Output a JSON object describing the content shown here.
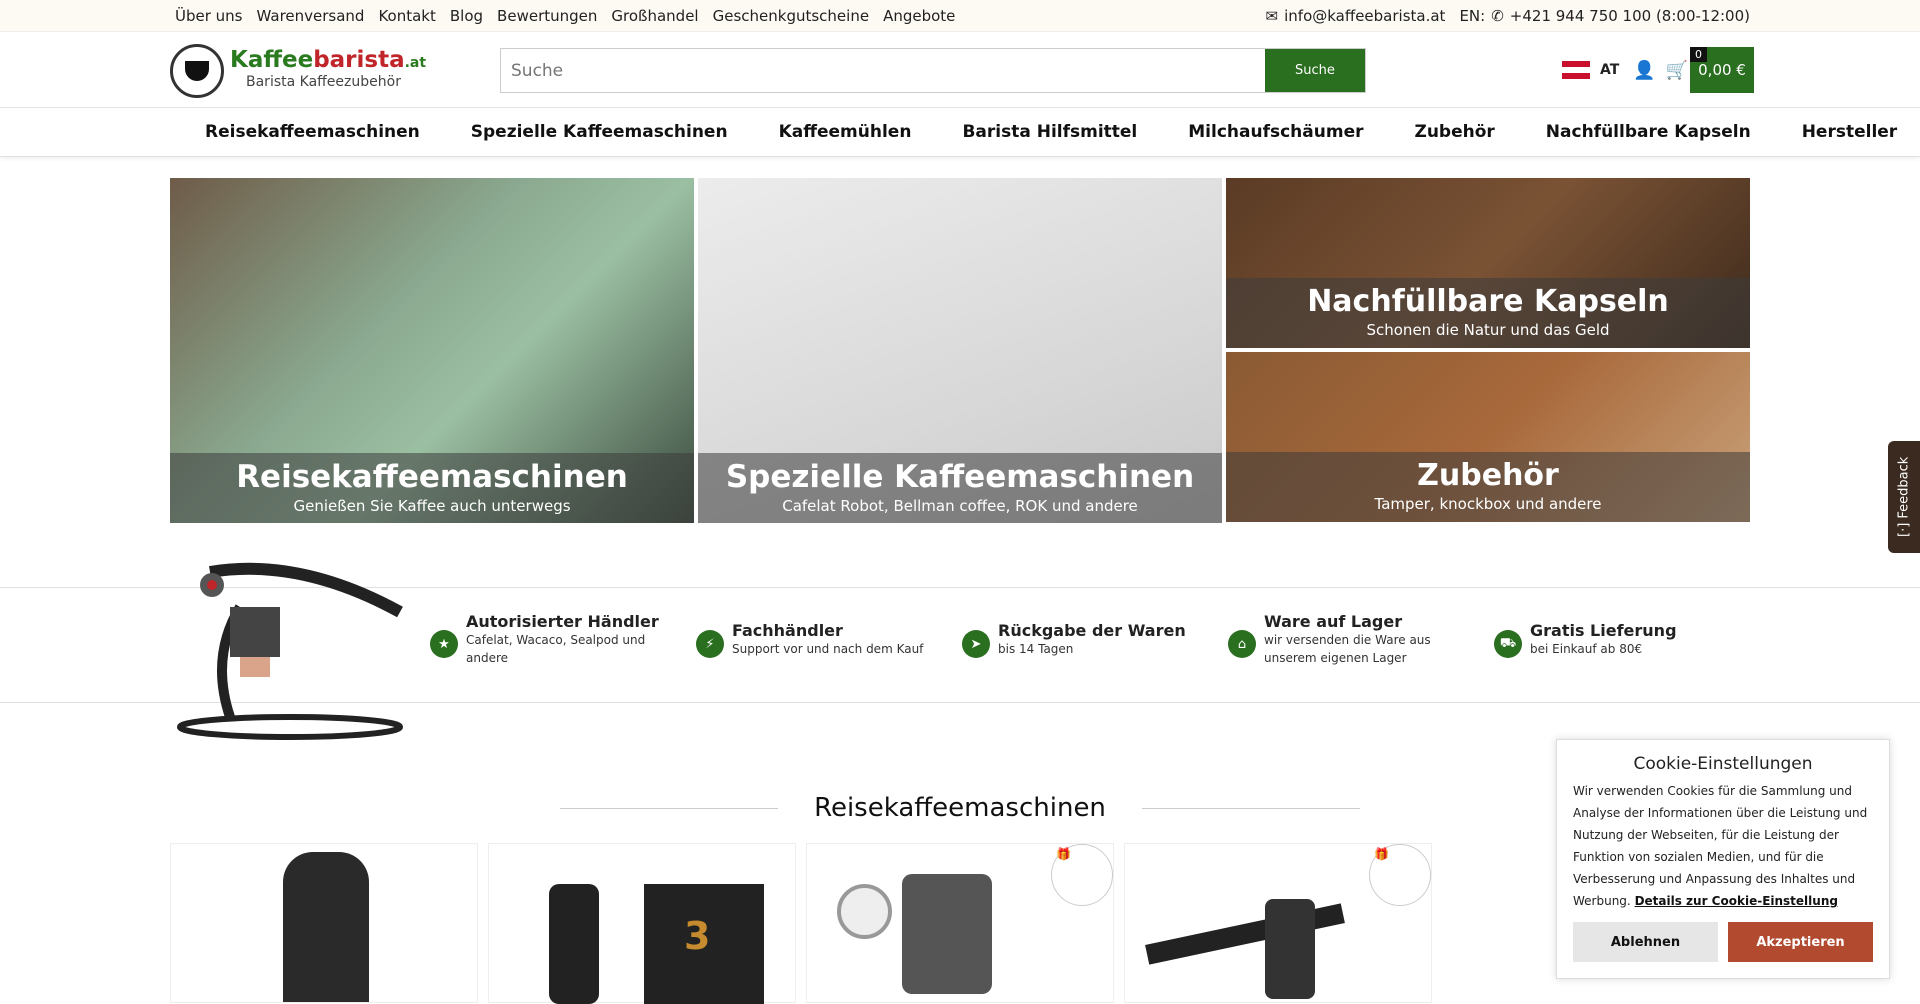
{
  "topbar": {
    "links": [
      "Über uns",
      "Warenversand",
      "Kontakt",
      "Blog",
      "Bewertungen",
      "Großhandel",
      "Geschenkgutscheine",
      "Angebote"
    ],
    "email": "info@kaffeebarista.at",
    "phone_prefix": "EN:",
    "phone": "+421 944 750 100 (8:00-12:00)"
  },
  "logo": {
    "name_a": "Kaffee",
    "name_b": "barista",
    "tld": ".at",
    "subtitle": "Barista Kaffeezubehör"
  },
  "search": {
    "placeholder": "Suche",
    "button": "Suche"
  },
  "header": {
    "lang": "AT",
    "cart_total": "0,00 €",
    "cart_count": "0"
  },
  "nav": [
    "Reisekaffeemaschinen",
    "Spezielle Kaffeemaschinen",
    "Kaffeemühlen",
    "Barista Hilfsmittel",
    "Milchaufschäumer",
    "Zubehör",
    "Nachfüllbare Kapseln",
    "Hersteller"
  ],
  "banners": [
    {
      "title": "Reisekaffeemaschinen",
      "sub": "Genießen Sie Kaffee auch unterwegs"
    },
    {
      "title": "Spezielle Kaffeemaschinen",
      "sub": "Cafelat Robot, Bellman coffee, ROK und andere"
    },
    {
      "title": "Nachfüllbare Kapseln",
      "sub": "Schonen die Natur und das Geld"
    },
    {
      "title": "Zubehör",
      "sub": "Tamper, knockbox und andere"
    }
  ],
  "features": [
    {
      "title": "Autorisierter Händler",
      "desc": "Cafelat, Wacaco, Sealpod und andere",
      "icon": "star-icon"
    },
    {
      "title": "Fachhändler",
      "desc": "Support vor und nach dem Kauf",
      "icon": "bolt-icon"
    },
    {
      "title": "Rückgabe der Waren",
      "desc": "bis 14 Tagen",
      "icon": "send-icon"
    },
    {
      "title": "Ware auf Lager",
      "desc": "wir versenden die Ware aus unserem eigenen Lager",
      "icon": "home-icon"
    },
    {
      "title": "Gratis Lieferung",
      "desc": "bei Einkauf ab 80€",
      "icon": "truck-icon"
    }
  ],
  "section": {
    "title": "Reisekaffeemaschinen"
  },
  "cookie": {
    "title": "Cookie-Einstellungen",
    "body": "Wir verwenden Cookies für die Sammlung und Analyse der Informationen über die Leistung und Nutzung der Webseiten, für die Leistung der Funktion von sozialen Medien, und für die Verbesserung und Anpassung des Inhaltes und Werbung.",
    "link": "Details zur Cookie-Einstellung",
    "reject": "Ablehnen",
    "accept": "Akzeptieren"
  },
  "feedback": "[·] Feedback",
  "colors": {
    "brand_green": "#2a6e1f",
    "accent_red": "#c0252a",
    "cookie_accept": "#b24a30"
  }
}
